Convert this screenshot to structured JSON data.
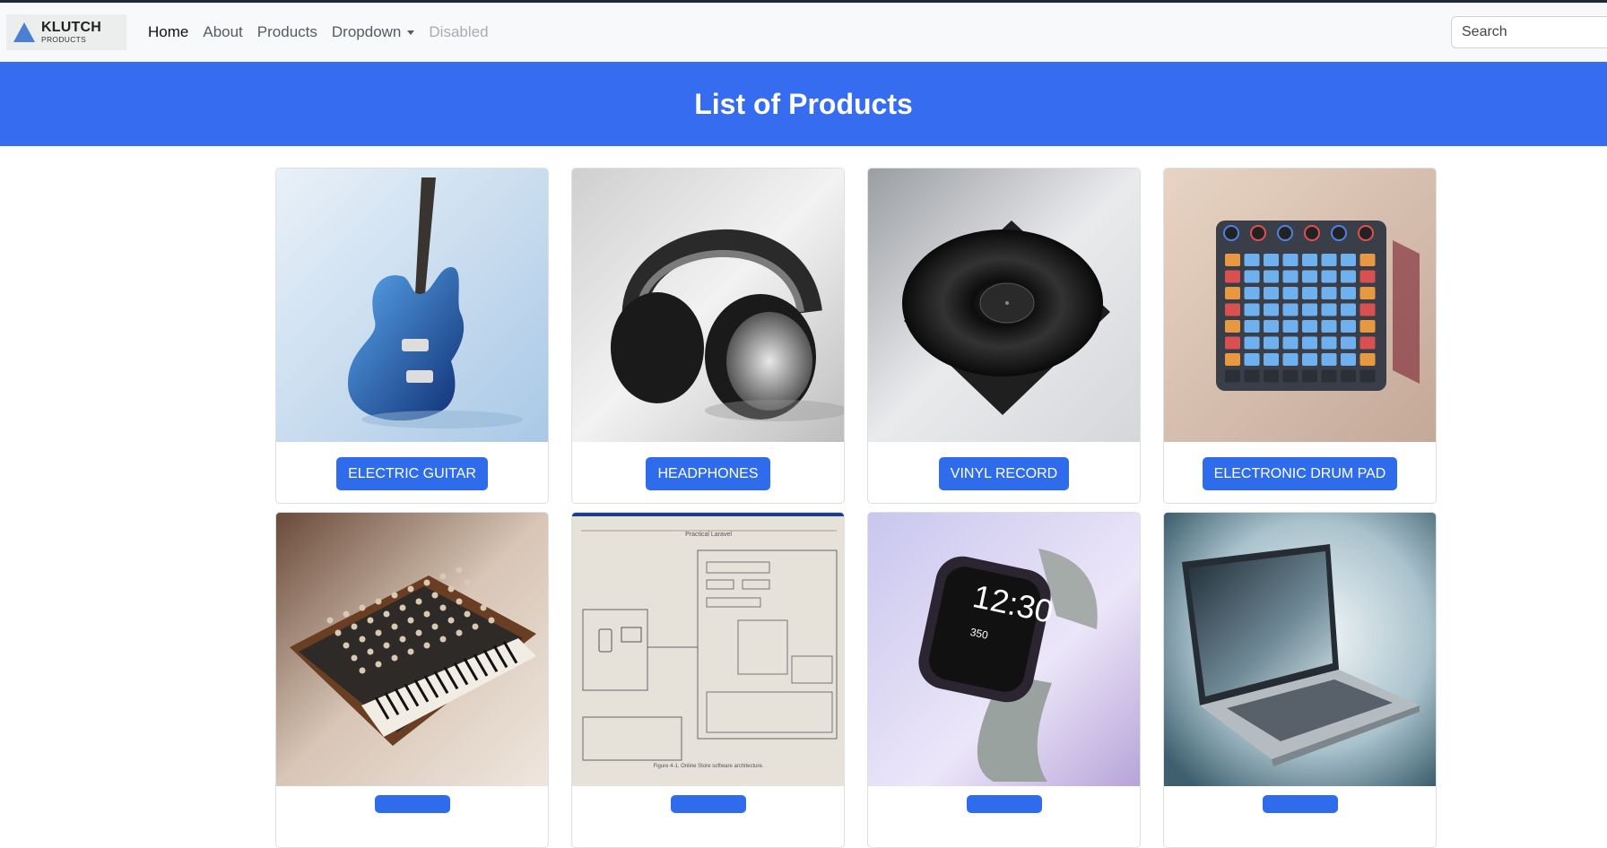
{
  "brand": {
    "title": "KLUTCH",
    "subtitle": "PRODUCTS"
  },
  "nav": {
    "home": "Home",
    "about": "About",
    "products": "Products",
    "dropdown": "Dropdown",
    "disabled": "Disabled"
  },
  "search": {
    "placeholder": "Search"
  },
  "hero": {
    "title": "List of Products"
  },
  "products": [
    {
      "label": "ELECTRIC GUITAR"
    },
    {
      "label": "HEADPHONES"
    },
    {
      "label": "VINYL RECORD"
    },
    {
      "label": "ELECTRONIC DRUM PAD"
    },
    {
      "label": ""
    },
    {
      "label": ""
    },
    {
      "label": ""
    },
    {
      "label": ""
    }
  ],
  "diagram_texts": {
    "heading": "Practical Laravel",
    "caption": "Figure 4-1. Online Store software architecture."
  },
  "watch_texts": {
    "time": "12:30",
    "heart": "350"
  },
  "colors": {
    "accent": "#2f6cec",
    "hero": "#366df0",
    "navbar": "#f8f9fa"
  }
}
